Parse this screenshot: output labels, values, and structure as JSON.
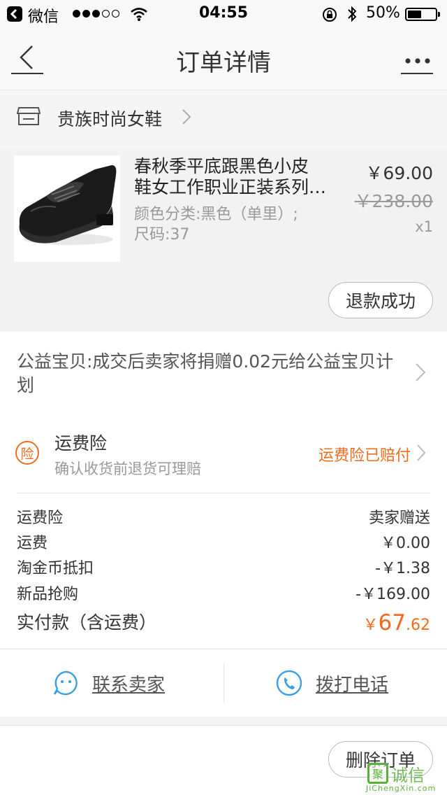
{
  "status_bar": {
    "carrier": "微信",
    "time": "04:55",
    "battery_percent": "50%",
    "battery_level": 0.5,
    "signal_full_dots": 3,
    "signal_total_dots": 5
  },
  "nav": {
    "title": "订单详情",
    "back_icon": "chevron-left-icon",
    "more_icon": "more-dots-icon"
  },
  "shop": {
    "name": "贵族时尚女鞋",
    "icon": "store-icon"
  },
  "product": {
    "title_line1": "春秋季平底跟黑色小皮",
    "title_line2": "鞋女工作职业正装系列单鞋",
    "spec_line1": "颜色分类:黑色（单里）;",
    "spec_line2": "尺码:37",
    "price": "￥69.00",
    "original_price": "￥238.00",
    "quantity": "x1",
    "refund_button": "退款成功"
  },
  "charity": {
    "text": "公益宝贝:成交后卖家将捐赠0.02元给公益宝贝计划"
  },
  "insurance": {
    "badge": "险",
    "title": "运费险",
    "subtitle": "确认收货前退货可理赔",
    "status": "运费险已赔付"
  },
  "fees": [
    {
      "label": "运费险",
      "value": "卖家赠送"
    },
    {
      "label": "运费",
      "value": "￥0.00"
    },
    {
      "label": "淘金币抵扣",
      "value": "-￥1.38"
    },
    {
      "label": "新品抢购",
      "value": "-￥169.00"
    }
  ],
  "total": {
    "label": "实付款（含运费）",
    "currency": "￥",
    "integer": "67",
    "decimal": ".62"
  },
  "contact": {
    "seller_label": "联系卖家",
    "phone_label": "拨打电话"
  },
  "footer": {
    "delete_button": "删除订单"
  },
  "watermark": {
    "badge": "聚",
    "text": "诚信",
    "url": "JiChengXin.com"
  },
  "colors": {
    "accent": "#f26b1d",
    "link_blue": "#3aa0e6",
    "watermark_green": "#5ab13a"
  }
}
